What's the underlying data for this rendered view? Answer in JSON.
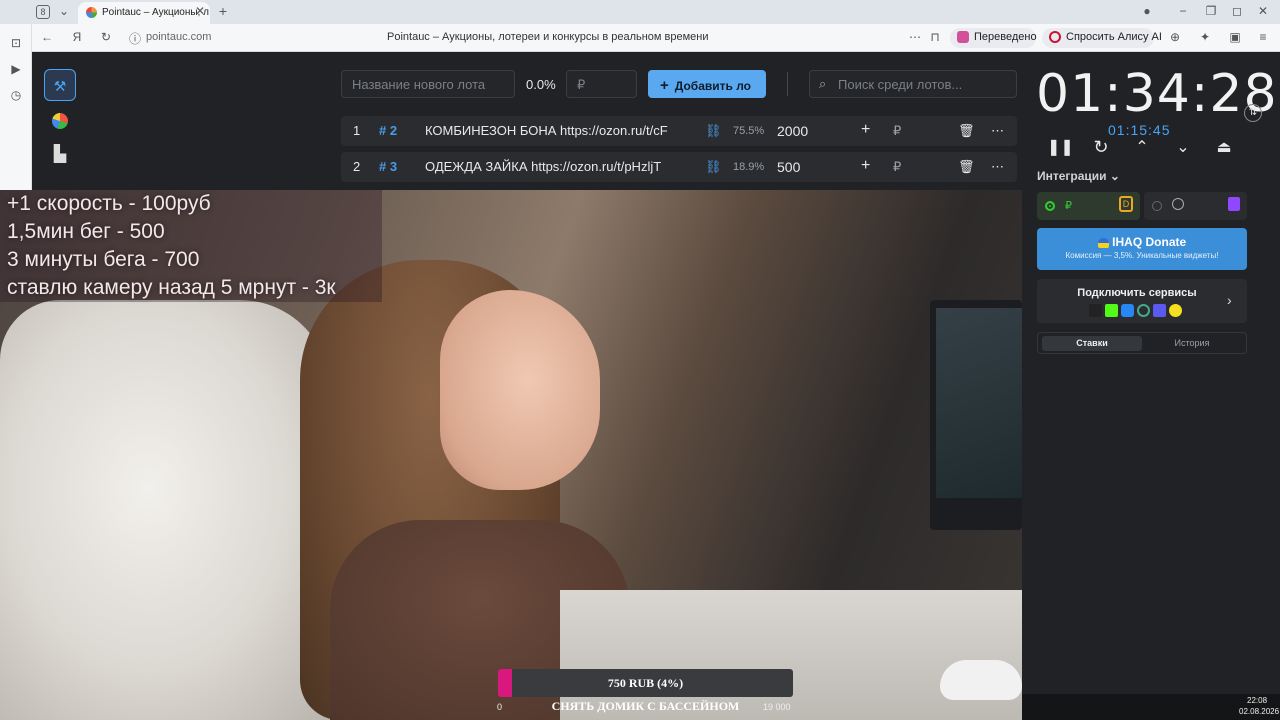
{
  "browser": {
    "tab_count": "8",
    "tab_title": "Pointauc – Аукционы, л",
    "url": "pointauc.com",
    "page_title": "Pointauc – Аукционы, лотереи и конкурсы в реальном времени",
    "translated_label": "Переведено",
    "ask_alice_label": "Спросить Алису AI"
  },
  "toolbar": {
    "new_lot_placeholder": "Название нового лота",
    "percent": "0.0%",
    "amount_placeholder": "₽",
    "add_button": "Добавить ло",
    "search_placeholder": "Поиск среди лотов..."
  },
  "lots": [
    {
      "index": "1",
      "id": "# 2",
      "name": "КОМБИНЕЗОН БОНА https://ozon.ru/t/cF",
      "percent": "75.5%",
      "amount": "2000",
      "currency": "₽"
    },
    {
      "index": "2",
      "id": "# 3",
      "name": "ОДЕЖДА ЗАЙКА https://ozon.ru/t/pHzljT",
      "percent": "18.9%",
      "amount": "500",
      "currency": "₽"
    }
  ],
  "overlay": {
    "lines": [
      "+1 скорость - 100руб",
      "1,5мин бег - 500",
      "3 минуты бега - 700",
      "ставлю камеру назад 5 мрнут - 3к"
    ]
  },
  "goal": {
    "amount_label": "750 RUB (4%)",
    "progress_fraction": 0.04,
    "min": "0",
    "max": "19 000",
    "title": "СНЯТЬ ДОМИК С БАССЕЙНОМ"
  },
  "timer": {
    "main": "01:34:28",
    "secondary": "01:15:45"
  },
  "integrations": {
    "label": "Интеграции",
    "donate_title": "IHAQ Donate",
    "donate_sub": "Комиссия — 3,5%. Уникальные виджеты!",
    "connect_label": "Подключить сервисы",
    "tab_bets": "Ставки",
    "tab_history": "История"
  },
  "clock": {
    "time": "22:08",
    "date": "02.08.2026"
  },
  "colors": {
    "accent_blue": "#4ba3f5",
    "donate_blue": "#3b8fd9",
    "progress_pink": "#d9187f",
    "id_blue": "#4b9be6"
  }
}
